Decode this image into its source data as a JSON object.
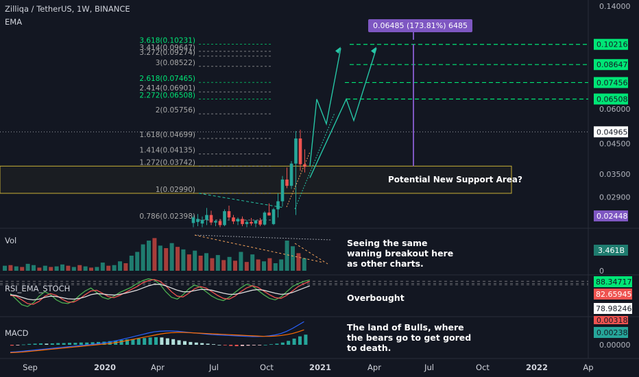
{
  "header": {
    "symbol_line": "Zilliqa / TetherUS, 1W, BINANCE",
    "indicator": "EMA"
  },
  "panes": {
    "volume_label": "Vol",
    "rsi_label": "RSI_EMA_STOCH",
    "macd_label": "MACD"
  },
  "annotations": {
    "measure": "0.06485 (173.81%) 6485",
    "support": "Potential New Support Area?",
    "volume_note": "Seeing the same waning breakout here as other charts.",
    "rsi_note": "Overbought",
    "macd_note": "The land of Bulls, where the bears go to get gored to death."
  },
  "colors": {
    "background": "#131722",
    "up": "#26a69a",
    "down": "#ef5350",
    "fib": "#a9a9a9",
    "target_line": "#00e676",
    "measure": "#7e57c2",
    "support_box": "#c9b037",
    "projection": "#26c6a6",
    "trendline": "#f5a35a"
  },
  "chart_data": [
    {
      "type": "candlestick",
      "title": "Zilliqa / TetherUS, 1W, BINANCE",
      "x_ticks": [
        "Sep",
        "2020",
        "Apr",
        "Jul",
        "Oct",
        "2021",
        "Apr",
        "Jul",
        "Oct",
        "2022",
        "Ap"
      ],
      "y_ticks": [
        "0.14000",
        "0.06000",
        "0.04500",
        "0.03500",
        "0.02900"
      ],
      "y_scale": "log",
      "ylim": [
        0.0225,
        0.14
      ],
      "price_labels": [
        {
          "value": "0.10216",
          "color": "#00e676"
        },
        {
          "value": "0.08647",
          "color": "#00e676"
        },
        {
          "value": "0.07456",
          "color": "#00e676"
        },
        {
          "value": "0.06508",
          "color": "#00e676"
        },
        {
          "value": "0.04965",
          "color": "#ffffff"
        },
        {
          "value": "0.02448",
          "color": "#7e57c2"
        }
      ],
      "fib_levels": [
        {
          "label": "3.618(0.10231)",
          "value": 0.10231,
          "color": "#00e676"
        },
        {
          "label": "3.414(0.09647)",
          "value": 0.09647,
          "color": "#a9a9a9"
        },
        {
          "label": "3.272(0.09274)",
          "value": 0.09274,
          "color": "#a9a9a9"
        },
        {
          "label": "3(0.08522)",
          "value": 0.08522,
          "color": "#a9a9a9"
        },
        {
          "label": "2.618(0.07465)",
          "value": 0.07465,
          "color": "#00e676"
        },
        {
          "label": "2.414(0.06901)",
          "value": 0.06901,
          "color": "#a9a9a9"
        },
        {
          "label": "2.272(0.06508)",
          "value": 0.06508,
          "color": "#00e676"
        },
        {
          "label": "2(0.05756)",
          "value": 0.05756,
          "color": "#a9a9a9"
        },
        {
          "label": "1.618(0.04699)",
          "value": 0.04699,
          "color": "#a9a9a9"
        },
        {
          "label": "1.414(0.04135)",
          "value": 0.04135,
          "color": "#a9a9a9"
        },
        {
          "label": "1.272(0.03742)",
          "value": 0.03742,
          "color": "#a9a9a9"
        },
        {
          "label": "1(0.02990)",
          "value": 0.0299,
          "color": "#a9a9a9"
        },
        {
          "label": "0.786(0.02398)",
          "value": 0.02398,
          "color": "#a9a9a9"
        }
      ],
      "target_levels": [
        0.10216,
        0.08647,
        0.07456,
        0.06508
      ],
      "last_price": 0.04965,
      "support_zone": [
        0.0299,
        0.03742
      ],
      "candles": [
        {
          "o": 0.0234,
          "h": 0.0249,
          "l": 0.0226,
          "c": 0.0245
        },
        {
          "o": 0.0236,
          "h": 0.0252,
          "l": 0.0228,
          "c": 0.0242
        },
        {
          "o": 0.0233,
          "h": 0.0247,
          "l": 0.0226,
          "c": 0.024
        },
        {
          "o": 0.024,
          "h": 0.0265,
          "l": 0.023,
          "c": 0.025
        },
        {
          "o": 0.025,
          "h": 0.0259,
          "l": 0.023,
          "c": 0.0235
        },
        {
          "o": 0.0235,
          "h": 0.024,
          "l": 0.0228,
          "c": 0.0238
        },
        {
          "o": 0.0238,
          "h": 0.0242,
          "l": 0.0226,
          "c": 0.023
        },
        {
          "o": 0.023,
          "h": 0.0262,
          "l": 0.0228,
          "c": 0.0258
        },
        {
          "o": 0.0258,
          "h": 0.027,
          "l": 0.0241,
          "c": 0.0245
        },
        {
          "o": 0.0245,
          "h": 0.025,
          "l": 0.0232,
          "c": 0.0237
        },
        {
          "o": 0.0237,
          "h": 0.0245,
          "l": 0.023,
          "c": 0.0242
        },
        {
          "o": 0.0242,
          "h": 0.0247,
          "l": 0.0228,
          "c": 0.0232
        },
        {
          "o": 0.0232,
          "h": 0.024,
          "l": 0.0226,
          "c": 0.0236
        },
        {
          "o": 0.0236,
          "h": 0.0244,
          "l": 0.0229,
          "c": 0.0233
        },
        {
          "o": 0.0233,
          "h": 0.024,
          "l": 0.0226,
          "c": 0.0239
        },
        {
          "o": 0.0239,
          "h": 0.0244,
          "l": 0.0228,
          "c": 0.0231
        },
        {
          "o": 0.0231,
          "h": 0.0258,
          "l": 0.0229,
          "c": 0.0255
        },
        {
          "o": 0.0255,
          "h": 0.0275,
          "l": 0.0249,
          "c": 0.0249
        },
        {
          "o": 0.0232,
          "h": 0.0265,
          "l": 0.023,
          "c": 0.0262
        },
        {
          "o": 0.0262,
          "h": 0.0299,
          "l": 0.0245,
          "c": 0.028
        },
        {
          "o": 0.028,
          "h": 0.0345,
          "l": 0.0268,
          "c": 0.0335
        },
        {
          "o": 0.0335,
          "h": 0.037,
          "l": 0.0312,
          "c": 0.0318
        },
        {
          "o": 0.0318,
          "h": 0.039,
          "l": 0.031,
          "c": 0.0382
        },
        {
          "o": 0.0382,
          "h": 0.05,
          "l": 0.025,
          "c": 0.047
        },
        {
          "o": 0.047,
          "h": 0.0505,
          "l": 0.036,
          "c": 0.038
        },
        {
          "o": 0.038,
          "h": 0.043,
          "l": 0.0355,
          "c": 0.0372
        }
      ],
      "projection_path": [
        {
          "x": "Dec 2020",
          "y": 0.0262
        },
        {
          "x": "Jan 2021",
          "y": 0.07
        },
        {
          "x": "Feb 2021",
          "y": 0.0525
        },
        {
          "x": "Mar 2021",
          "y": 0.099
        },
        {
          "x": "Apr 2021",
          "y": 0.065
        },
        {
          "x": "Apr 2021",
          "y": 0.0995
        }
      ],
      "projection_path_2": [
        {
          "x": "Dec 2020",
          "y": 0.0262
        },
        {
          "x": "Feb 2021",
          "y": 0.07
        },
        {
          "x": "Mar 2021",
          "y": 0.0525
        },
        {
          "x": "Apr 2021",
          "y": 0.099
        }
      ]
    },
    {
      "type": "bar",
      "title": "Vol",
      "current_label": "3.461B",
      "y_ticks": [
        "0"
      ],
      "values": [
        0.8,
        0.9,
        0.7,
        0.6,
        1.1,
        0.9,
        0.5,
        0.8,
        0.6,
        0.7,
        1.0,
        0.8,
        0.6,
        0.9,
        0.7,
        0.5,
        0.6,
        1.3,
        0.8,
        0.9,
        1.5,
        1.2,
        2.4,
        3.0,
        4.2,
        4.8,
        5.2,
        4.0,
        3.6,
        4.4,
        3.8,
        3.4,
        2.6,
        3.2,
        2.4,
        2.8,
        2.0,
        2.5,
        1.7,
        2.2,
        1.6,
        3.0,
        1.4,
        2.6,
        1.8,
        1.5,
        2.0,
        1.2,
        1.8,
        4.8,
        3.9,
        2.8,
        2.0
      ],
      "up": [
        1,
        0,
        1,
        0,
        1,
        1,
        0,
        1,
        0,
        1,
        1,
        0,
        1,
        0,
        1,
        0,
        1,
        1,
        0,
        1,
        1,
        0,
        1,
        1,
        1,
        1,
        0,
        1,
        0,
        1,
        0,
        1,
        0,
        1,
        0,
        1,
        0,
        1,
        0,
        1,
        0,
        1,
        0,
        1,
        0,
        1,
        0,
        1,
        1,
        1,
        1,
        0,
        1
      ]
    },
    {
      "type": "line",
      "title": "RSI_EMA_STOCH",
      "levels": [
        "88.34717",
        "82.65945",
        "78.98246"
      ],
      "level_colors": [
        "#00e676",
        "#ef5350",
        "#ffffff"
      ],
      "ylim": [
        0,
        100
      ],
      "series": [
        {
          "name": "k",
          "color": "#4caf50",
          "values": [
            55,
            40,
            25,
            20,
            30,
            48,
            60,
            52,
            38,
            30,
            28,
            35,
            50,
            62,
            70,
            58,
            45,
            40,
            48,
            58,
            65,
            72,
            82,
            90,
            95,
            92,
            80,
            60,
            45,
            40,
            52,
            68,
            78,
            72,
            60,
            48,
            40,
            36,
            45,
            58,
            70,
            80,
            76,
            64,
            52,
            42,
            38,
            46,
            60,
            74,
            82,
            88,
            92
          ]
        },
        {
          "name": "d",
          "color": "#ef5350",
          "values": [
            50,
            48,
            38,
            28,
            26,
            34,
            48,
            55,
            50,
            40,
            32,
            32,
            40,
            52,
            62,
            64,
            56,
            47,
            44,
            50,
            58,
            66,
            74,
            84,
            90,
            93,
            88,
            76,
            60,
            48,
            46,
            56,
            68,
            74,
            70,
            60,
            50,
            42,
            40,
            48,
            60,
            70,
            76,
            72,
            62,
            52,
            44,
            42,
            50,
            62,
            74,
            82,
            88
          ]
        },
        {
          "name": "ema",
          "color": "#e0e0e0",
          "values": [
            52,
            50,
            45,
            40,
            38,
            40,
            45,
            48,
            47,
            44,
            41,
            40,
            42,
            46,
            52,
            55,
            54,
            52,
            51,
            53,
            56,
            60,
            64,
            70,
            76,
            80,
            80,
            76,
            70,
            64,
            60,
            60,
            63,
            66,
            66,
            64,
            60,
            56,
            53,
            53,
            56,
            60,
            64,
            66,
            64,
            60,
            56,
            53,
            54,
            58,
            64,
            70,
            76
          ]
        }
      ]
    },
    {
      "type": "bar",
      "title": "MACD",
      "labels": [
        "0.00318",
        "0.00238",
        "0.00000"
      ],
      "histogram": [
        -0.3,
        -0.2,
        0.1,
        0.3,
        0.4,
        0.5,
        0.4,
        0.5,
        0.6,
        0.6,
        0.7,
        0.7,
        0.8,
        0.8,
        0.9,
        1.0,
        1.1,
        1.3,
        1.5,
        1.7,
        1.9,
        2.0,
        2.2,
        2.4,
        2.6,
        2.7,
        2.6,
        2.3,
        2.0,
        1.6,
        1.3,
        1.0,
        0.8,
        0.6,
        0.4,
        0.2,
        0.0,
        -0.2,
        -0.4,
        -0.5,
        -0.4,
        -0.3,
        -0.2,
        -0.1,
        0.0,
        0.2,
        0.4,
        0.8,
        1.4,
        2.2,
        3.0,
        3.6
      ],
      "macd": [
        -2.6,
        -2.5,
        -2.3,
        -2.1,
        -1.9,
        -1.7,
        -1.5,
        -1.3,
        -1.1,
        -0.9,
        -0.7,
        -0.5,
        -0.3,
        -0.1,
        0.1,
        0.3,
        0.6,
        0.9,
        1.3,
        1.7,
        2.2,
        2.7,
        3.2,
        3.7,
        4.2,
        4.6,
        4.8,
        4.9,
        4.9,
        4.8,
        4.6,
        4.4,
        4.2,
        4.0,
        3.8,
        3.6,
        3.5,
        3.4,
        3.3,
        3.2,
        3.1,
        3.0,
        2.9,
        2.9,
        3.0,
        3.2,
        3.5,
        4.0,
        4.8,
        5.8,
        7.0,
        8.2
      ],
      "signal": [
        -2.8,
        -2.7,
        -2.6,
        -2.4,
        -2.2,
        -2.0,
        -1.8,
        -1.6,
        -1.4,
        -1.2,
        -1.0,
        -0.8,
        -0.6,
        -0.4,
        -0.2,
        0.0,
        0.2,
        0.4,
        0.7,
        1.0,
        1.4,
        1.8,
        2.2,
        2.6,
        3.0,
        3.4,
        3.8,
        4.1,
        4.3,
        4.4,
        4.4,
        4.3,
        4.2,
        4.1,
        4.0,
        3.9,
        3.8,
        3.7,
        3.6,
        3.5,
        3.4,
        3.3,
        3.2,
        3.1,
        3.0,
        3.0,
        3.1,
        3.3,
        3.6,
        4.0,
        4.6,
        5.3
      ]
    }
  ]
}
